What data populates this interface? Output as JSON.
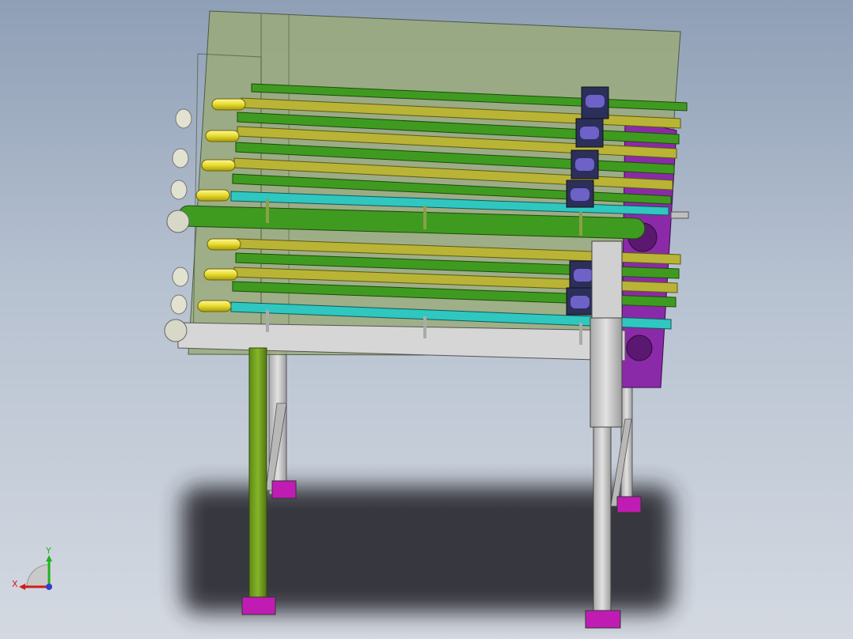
{
  "viewport": {
    "background_top": "#8f9fb6",
    "background_bottom": "#d4d9e1"
  },
  "model": {
    "description_type": "conveyor-rack-assembly",
    "colors": {
      "housing": "#9aab79",
      "roller_green": "#3f9b1f",
      "roller_olive": "#b9b436",
      "roller_yellow": "#e8e247",
      "roller_cyan": "#2fc7c0",
      "chain_dark": "#2b2f5a",
      "chain_purple": "#6e62c9",
      "side_plate": "#8b2aa8",
      "frame_grey": "#c9c9c9",
      "leg_green": "#6c9a1e",
      "foot_magenta": "#c01cb3",
      "shadow": "#2d2f33"
    }
  },
  "triad": {
    "x_label": "X",
    "y_label": "Y",
    "x_color": "#d21b1b",
    "y_color": "#1db31d",
    "z_color": "#2f3fd0"
  }
}
